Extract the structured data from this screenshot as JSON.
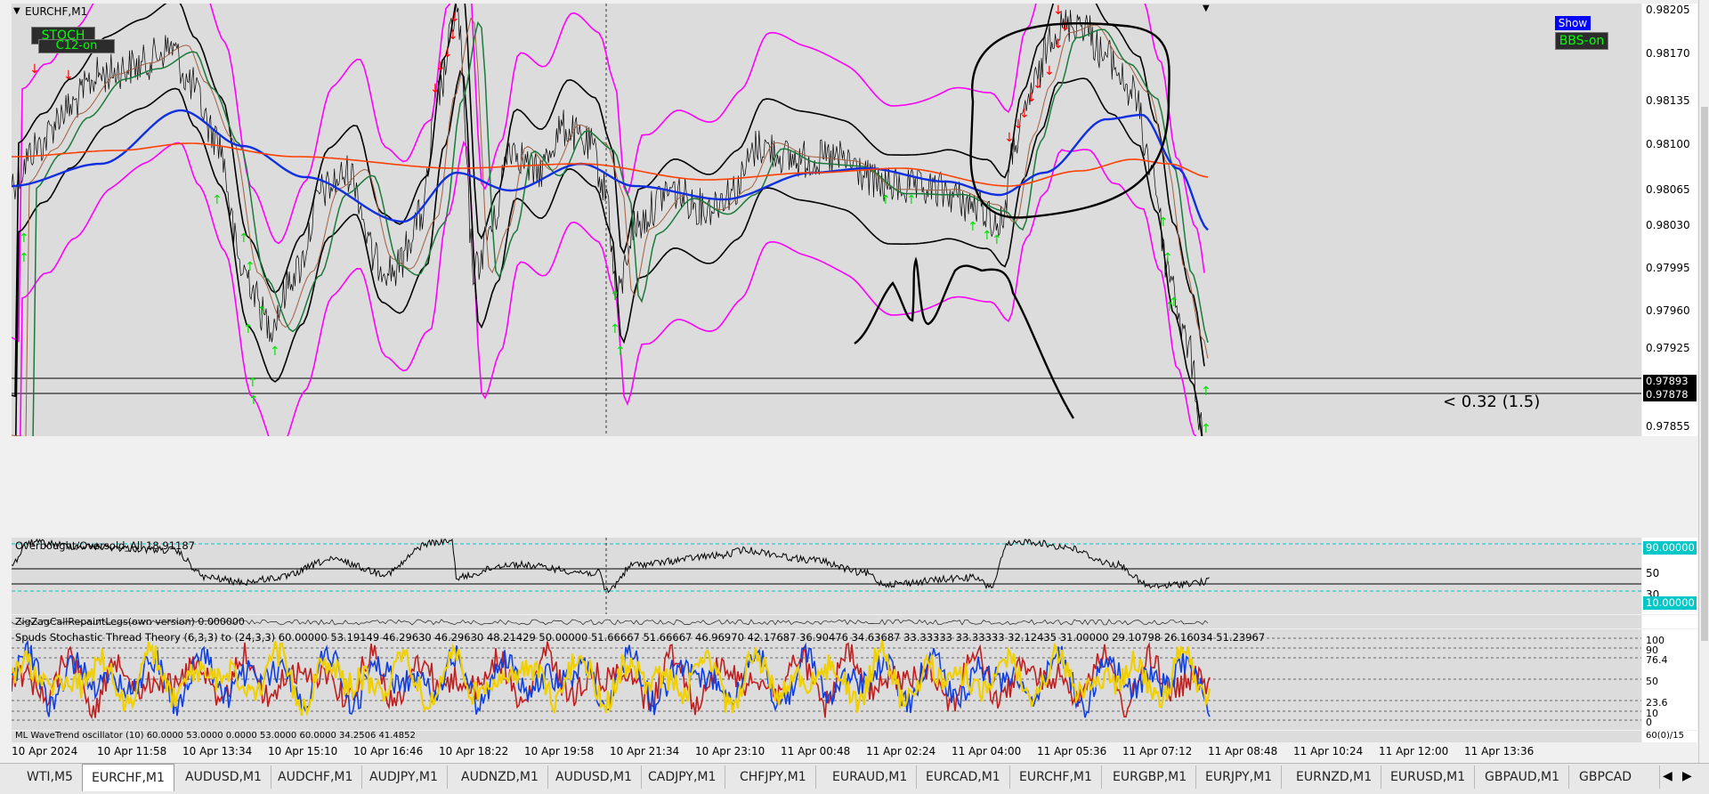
{
  "window": {
    "title": "EURCHF,M1"
  },
  "buttons": {
    "stoch": "STOCH",
    "c12": "C12-on",
    "show": "Show",
    "bbs": "BBS-on"
  },
  "main_price_axis": [
    "0.98205",
    "0.98170",
    "0.98135",
    "0.98100",
    "0.98065",
    "0.98030",
    "0.97995",
    "0.97960",
    "0.97925",
    "0.97855"
  ],
  "price_levels": [
    {
      "value": "0.97893",
      "color": "#000000"
    },
    {
      "value": "0.97878",
      "color": "#000000"
    }
  ],
  "annotation": "< 0.32 (1.5)",
  "indicator1": {
    "title": "Overbought/Oversold_All 18.91187",
    "axis": [
      "90.00000",
      "50",
      "30",
      "10.00000"
    ],
    "level_colors": {
      "overbought": "#00c8c8",
      "oversold": "#00c8c8"
    }
  },
  "indicator2": {
    "title": "ZigZagCallRepaintLegs(own version) 0.000000"
  },
  "indicator3": {
    "title": "Spuds Stochastic Thread Theory (6,3,3) to (24,3,3) 60.00000 53.19149 46.29630 46.29630 48.21429 50.00000 51.66667 51.66667 46.96970 42.17687 36.90476 34.63687 33.33333 33.33333 32.12435 31.00000 29.10798 26.16034 51.23967",
    "axis": [
      "100",
      "90",
      "76.4",
      "50",
      "23.6",
      "10",
      "0"
    ],
    "colors": [
      "#f0d000",
      "#1040e0",
      "#c02020"
    ]
  },
  "indicator4": {
    "title": "ML WaveTrend oscillator (10) 60.0000 53.0000 0.0000 53.0000 60.0000 34.2506 41.4852",
    "axis": "60(0)/15"
  },
  "time_axis": [
    "10 Apr 2024",
    "10 Apr 11:58",
    "10 Apr 13:34",
    "10 Apr 15:10",
    "10 Apr 16:46",
    "10 Apr 18:22",
    "10 Apr 19:58",
    "10 Apr 21:34",
    "10 Apr 23:10",
    "11 Apr 00:48",
    "11 Apr 02:24",
    "11 Apr 04:00",
    "11 Apr 05:36",
    "11 Apr 07:12",
    "11 Apr 08:48",
    "11 Apr 10:24",
    "11 Apr 12:00",
    "11 Apr 13:36"
  ],
  "tabs": [
    "WTI,M5",
    "EURCHF,M1",
    "AUDUSD,M1",
    "AUDCHF,M1",
    "AUDJPY,M1",
    "AUDNZD,M1",
    "AUDUSD,M1",
    "CADJPY,M1",
    "CHFJPY,M1",
    "EURAUD,M1",
    "EURCAD,M1",
    "EURCHF,M1",
    "EURGBP,M1",
    "EURJPY,M1",
    "EURNZD,M1",
    "EURUSD,M1",
    "GBPAUD,M1",
    "GBPCAD"
  ],
  "active_tab": "EURCHF,M1",
  "colors": {
    "chart_bg": "#dcdcdc",
    "price": "#000000",
    "bollinger": "#ff00ff",
    "ma_fast": "#1030e0",
    "ma_slow": "#ff4000",
    "ma_green": "#1a7a3a",
    "ma_brown": "#a06040",
    "arrow_up": "#00dd00",
    "arrow_down": "#ff0000",
    "button_green_bg": "#2c2c2c",
    "button_text_green": "#00ff00",
    "show_bg": "#0000ff"
  },
  "icons": {
    "collapse": "triangle-down-icon",
    "scroll_right": "chevron-right-icon",
    "scroll_left": "chevron-left-icon"
  }
}
